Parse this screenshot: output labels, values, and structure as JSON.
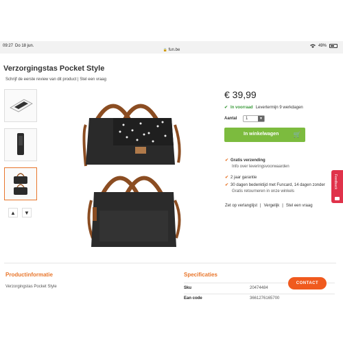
{
  "status": {
    "time": "09:27",
    "date": "Do 18 jun.",
    "battery": "49%"
  },
  "url": "fun.be",
  "product": {
    "title": "Verzorgingstas Pocket Style",
    "review_prompt": "Schrijf de eerste review van dit product | Stel een vraag",
    "price": "€ 39,99",
    "stock": "In voorraad",
    "delivery": "Levertermijn 9 werkdagen",
    "qty_label": "Aantal",
    "qty_value": "1",
    "cart_label": "In winkelwagen"
  },
  "usps": [
    {
      "title": "Gratis verzending",
      "sub": "Info over leveringsvoorwaarden"
    },
    {
      "title": "2 jaar garantie",
      "sub": ""
    },
    {
      "title": "30 dagen bedenktijd met Funcard, 14 dagen zonder",
      "sub": "Gratis retourneren in onze winkels"
    }
  ],
  "links": {
    "wishlist": "Zet op verlanglijst",
    "compare": "Vergelijk",
    "question": "Stel een vraag",
    "sep": "|"
  },
  "feedback": "Feedback",
  "info": {
    "title": "Productinformatie",
    "text": "Verzorgingstas Pocket Style"
  },
  "specs": {
    "title": "Specificaties",
    "rows": [
      {
        "key": "Sku",
        "value": "20474484"
      },
      {
        "key": "Ean code",
        "value": "3661276165700"
      }
    ]
  },
  "contact": "CONTACT",
  "colors": {
    "accent": "#e8752a",
    "cart": "#7cbb3e",
    "contact": "#f05a1e",
    "feedback": "#e0324a",
    "stock": "#3a9a3a"
  },
  "icons": [
    "lock-icon",
    "wifi-icon",
    "battery-icon",
    "check-icon",
    "cart-icon",
    "chevron-up-icon",
    "chevron-down-icon",
    "feedback-icon"
  ]
}
